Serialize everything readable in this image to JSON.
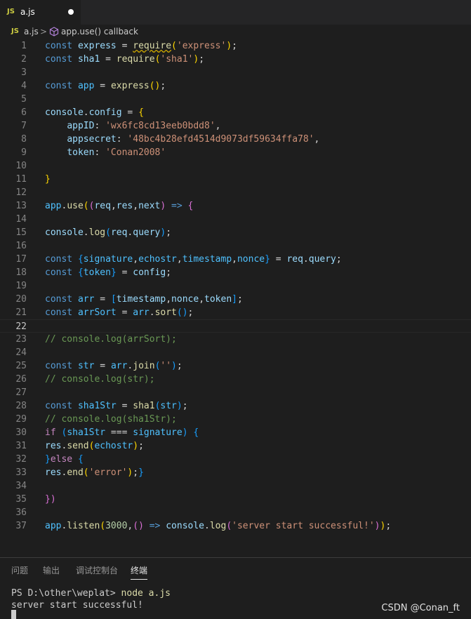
{
  "tabs": [
    {
      "badge": "JS",
      "label": "a.js",
      "modified": true
    }
  ],
  "breadcrumb": {
    "badge": "JS",
    "file": "a.js",
    "separator": ">",
    "symbol_icon": "cube-icon",
    "symbol": "app.use() callback"
  },
  "editor": {
    "current_line": 22,
    "line_numbers": [
      "1",
      "2",
      "3",
      "4",
      "5",
      "6",
      "7",
      "8",
      "9",
      "10",
      "11",
      "12",
      "13",
      "14",
      "15",
      "16",
      "17",
      "18",
      "19",
      "20",
      "21",
      "22",
      "23",
      "24",
      "25",
      "26",
      "27",
      "28",
      "29",
      "30",
      "31",
      "32",
      "33",
      "34",
      "35",
      "36",
      "37"
    ],
    "lines": [
      [
        [
          "kw",
          "const"
        ],
        [
          "p",
          " "
        ],
        [
          "var",
          "express"
        ],
        [
          "p",
          " = "
        ],
        [
          "fn warn",
          "require"
        ],
        [
          "b1",
          "("
        ],
        [
          "str",
          "'express'"
        ],
        [
          "b1",
          ")"
        ],
        [
          "p",
          ";"
        ]
      ],
      [
        [
          "kw",
          "const"
        ],
        [
          "p",
          " "
        ],
        [
          "var",
          "sha1"
        ],
        [
          "p",
          " = "
        ],
        [
          "fn",
          "require"
        ],
        [
          "b1",
          "("
        ],
        [
          "str",
          "'sha1'"
        ],
        [
          "b1",
          ")"
        ],
        [
          "p",
          ";"
        ]
      ],
      [],
      [
        [
          "kw",
          "const"
        ],
        [
          "p",
          " "
        ],
        [
          "cst",
          "app"
        ],
        [
          "p",
          " = "
        ],
        [
          "fn",
          "express"
        ],
        [
          "b1",
          "()"
        ],
        [
          "p",
          ";"
        ]
      ],
      [],
      [
        [
          "var",
          "console"
        ],
        [
          "p",
          "."
        ],
        [
          "var",
          "config"
        ],
        [
          "p",
          " = "
        ],
        [
          "b1",
          "{"
        ]
      ],
      [
        [
          "p",
          "    "
        ],
        [
          "var",
          "appID"
        ],
        [
          "p",
          ": "
        ],
        [
          "str",
          "'wx6fc8cd13eeb0bdd8'"
        ],
        [
          "p",
          ","
        ]
      ],
      [
        [
          "p",
          "    "
        ],
        [
          "var",
          "appsecret"
        ],
        [
          "p",
          ": "
        ],
        [
          "str",
          "'48bc4b28efd4514d9073df59634ffa78'"
        ],
        [
          "p",
          ","
        ]
      ],
      [
        [
          "p",
          "    "
        ],
        [
          "var",
          "token"
        ],
        [
          "p",
          ": "
        ],
        [
          "str",
          "'Conan2008'"
        ]
      ],
      [],
      [
        [
          "b1",
          "}"
        ]
      ],
      [],
      [
        [
          "cst",
          "app"
        ],
        [
          "p",
          "."
        ],
        [
          "fn",
          "use"
        ],
        [
          "b1",
          "("
        ],
        [
          "b2",
          "("
        ],
        [
          "var",
          "req"
        ],
        [
          "p",
          ","
        ],
        [
          "var",
          "res"
        ],
        [
          "p",
          ","
        ],
        [
          "var",
          "next"
        ],
        [
          "b2",
          ")"
        ],
        [
          "p",
          " "
        ],
        [
          "kw",
          "=>"
        ],
        [
          "p",
          " "
        ],
        [
          "b2",
          "{"
        ]
      ],
      [],
      [
        [
          "var",
          "console"
        ],
        [
          "p",
          "."
        ],
        [
          "fn",
          "log"
        ],
        [
          "b3",
          "("
        ],
        [
          "var",
          "req"
        ],
        [
          "p",
          "."
        ],
        [
          "var",
          "query"
        ],
        [
          "b3",
          ")"
        ],
        [
          "p",
          ";"
        ]
      ],
      [],
      [
        [
          "kw",
          "const"
        ],
        [
          "p",
          " "
        ],
        [
          "b3",
          "{"
        ],
        [
          "cst",
          "signature"
        ],
        [
          "p",
          ","
        ],
        [
          "cst",
          "echostr"
        ],
        [
          "p",
          ","
        ],
        [
          "cst",
          "timestamp"
        ],
        [
          "p",
          ","
        ],
        [
          "cst",
          "nonce"
        ],
        [
          "b3",
          "}"
        ],
        [
          "p",
          " = "
        ],
        [
          "var",
          "req"
        ],
        [
          "p",
          "."
        ],
        [
          "var",
          "query"
        ],
        [
          "p",
          ";"
        ]
      ],
      [
        [
          "kw",
          "const"
        ],
        [
          "p",
          " "
        ],
        [
          "b3",
          "{"
        ],
        [
          "cst",
          "token"
        ],
        [
          "b3",
          "}"
        ],
        [
          "p",
          " = "
        ],
        [
          "var",
          "config"
        ],
        [
          "p",
          ";"
        ]
      ],
      [],
      [
        [
          "kw",
          "const"
        ],
        [
          "p",
          " "
        ],
        [
          "cst",
          "arr"
        ],
        [
          "p",
          " = "
        ],
        [
          "b3",
          "["
        ],
        [
          "var",
          "timestamp"
        ],
        [
          "p",
          ","
        ],
        [
          "var",
          "nonce"
        ],
        [
          "p",
          ","
        ],
        [
          "var",
          "token"
        ],
        [
          "b3",
          "]"
        ],
        [
          "p",
          ";"
        ]
      ],
      [
        [
          "kw",
          "const"
        ],
        [
          "p",
          " "
        ],
        [
          "cst",
          "arrSort"
        ],
        [
          "p",
          " = "
        ],
        [
          "cst",
          "arr"
        ],
        [
          "p",
          "."
        ],
        [
          "fn",
          "sort"
        ],
        [
          "b3",
          "()"
        ],
        [
          "p",
          ";"
        ]
      ],
      [],
      [
        [
          "cmt",
          "// console.log(arrSort);"
        ]
      ],
      [],
      [
        [
          "kw",
          "const"
        ],
        [
          "p",
          " "
        ],
        [
          "cst",
          "str"
        ],
        [
          "p",
          " = "
        ],
        [
          "cst",
          "arr"
        ],
        [
          "p",
          "."
        ],
        [
          "fn",
          "join"
        ],
        [
          "b3",
          "("
        ],
        [
          "str",
          "''"
        ],
        [
          "b3",
          ")"
        ],
        [
          "p",
          ";"
        ]
      ],
      [
        [
          "cmt",
          "// console.log(str);"
        ]
      ],
      [],
      [
        [
          "kw",
          "const"
        ],
        [
          "p",
          " "
        ],
        [
          "cst",
          "sha1Str"
        ],
        [
          "p",
          " = "
        ],
        [
          "fn",
          "sha1"
        ],
        [
          "b3",
          "("
        ],
        [
          "cst",
          "str"
        ],
        [
          "b3",
          ")"
        ],
        [
          "p",
          ";"
        ]
      ],
      [
        [
          "cmt",
          "// console.log(sha1Str);"
        ]
      ],
      [
        [
          "ctl",
          "if"
        ],
        [
          "p",
          " "
        ],
        [
          "b3",
          "("
        ],
        [
          "cst",
          "sha1Str"
        ],
        [
          "p",
          " === "
        ],
        [
          "cst",
          "signature"
        ],
        [
          "b3",
          ")"
        ],
        [
          "p",
          " "
        ],
        [
          "b3",
          "{"
        ]
      ],
      [
        [
          "var",
          "res"
        ],
        [
          "p",
          "."
        ],
        [
          "fn",
          "send"
        ],
        [
          "b1",
          "("
        ],
        [
          "cst",
          "echostr"
        ],
        [
          "b1",
          ")"
        ],
        [
          "p",
          ";"
        ]
      ],
      [
        [
          "b3",
          "}"
        ],
        [
          "ctl",
          "else"
        ],
        [
          "p",
          " "
        ],
        [
          "b3",
          "{"
        ]
      ],
      [
        [
          "var",
          "res"
        ],
        [
          "p",
          "."
        ],
        [
          "fn",
          "end"
        ],
        [
          "b1",
          "("
        ],
        [
          "str",
          "'error'"
        ],
        [
          "b1",
          ")"
        ],
        [
          "p",
          ";"
        ],
        [
          "b3",
          "}"
        ]
      ],
      [],
      [
        [
          "b2",
          "})"
        ]
      ],
      [],
      [
        [
          "cst",
          "app"
        ],
        [
          "p",
          "."
        ],
        [
          "fn",
          "listen"
        ],
        [
          "b1",
          "("
        ],
        [
          "num",
          "3000"
        ],
        [
          "p",
          ","
        ],
        [
          "b2",
          "()"
        ],
        [
          "p",
          " "
        ],
        [
          "kw",
          "=>"
        ],
        [
          "p",
          " "
        ],
        [
          "var",
          "console"
        ],
        [
          "p",
          "."
        ],
        [
          "fn",
          "log"
        ],
        [
          "b2",
          "("
        ],
        [
          "str",
          "'server start successful!'"
        ],
        [
          "b2",
          ")"
        ],
        [
          "b1",
          ")"
        ],
        [
          "p",
          ";"
        ]
      ]
    ]
  },
  "panel": {
    "tabs": [
      {
        "label": "问题",
        "active": false
      },
      {
        "label": "输出",
        "active": false
      },
      {
        "label": "调试控制台",
        "active": false
      },
      {
        "label": "终端",
        "active": true
      }
    ],
    "terminal": {
      "prompt": "PS D:\\other\\weplat> ",
      "command": "node a.js",
      "output": "server start successful!"
    }
  },
  "watermark": "CSDN @Conan_ft"
}
